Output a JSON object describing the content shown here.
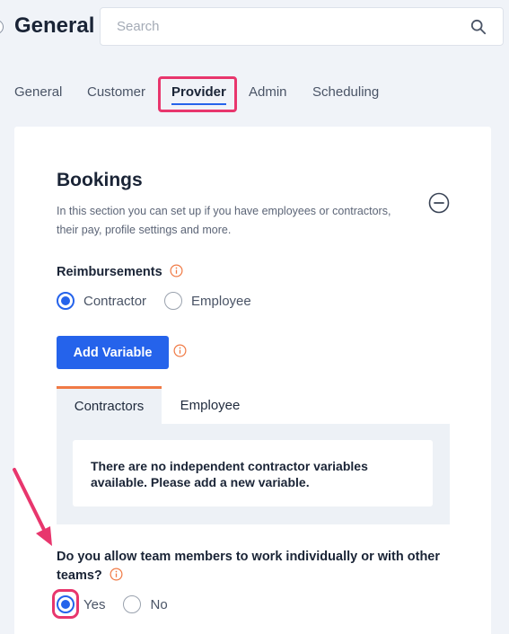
{
  "header": {
    "title": "General",
    "search_placeholder": "Search"
  },
  "tabs": [
    {
      "label": "General",
      "active": false
    },
    {
      "label": "Customer",
      "active": false
    },
    {
      "label": "Provider",
      "active": true
    },
    {
      "label": "Admin",
      "active": false
    },
    {
      "label": "Scheduling",
      "active": false
    }
  ],
  "section": {
    "title": "Bookings",
    "description": "In this section you can set up if you have employees or contractors, their pay, profile settings and more."
  },
  "reimbursements": {
    "label": "Reimbursements",
    "options": [
      {
        "label": "Contractor",
        "checked": true
      },
      {
        "label": "Employee",
        "checked": false
      }
    ]
  },
  "add_variable_label": "Add Variable",
  "subtabs": [
    {
      "label": "Contractors",
      "active": true
    },
    {
      "label": "Employee",
      "active": false
    }
  ],
  "empty_message": "There are no independent contractor variables available. Please add a new variable.",
  "team_question": {
    "label": "Do you allow team members to work individually or with other teams?",
    "options": [
      {
        "label": "Yes",
        "checked": true
      },
      {
        "label": "No",
        "checked": false
      }
    ]
  },
  "colors": {
    "accent": "#2563eb",
    "highlight": "#e8366d",
    "tab_indicator": "#f07a45",
    "info": "#f07a45"
  }
}
